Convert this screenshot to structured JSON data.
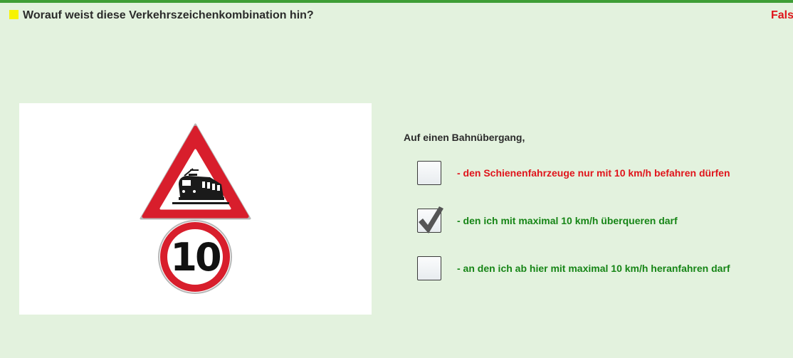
{
  "question": {
    "text": "Worauf weist diese Verkehrszeichenkombination hin?",
    "marker_color": "#f7f300"
  },
  "result": {
    "label": "Fals",
    "color": "#e0141b"
  },
  "image": {
    "sign_top": "railway-crossing-warning-triangle",
    "sign_bottom": "speed-limit-circle",
    "speed_limit_text": "10"
  },
  "answers": {
    "intro": "Auf einen Bahnübergang,",
    "options": [
      {
        "text": "- den Schienenfahrzeuge nur mit 10 km/h befahren dürfen",
        "checked": false,
        "color": "#e0141b"
      },
      {
        "text": "- den ich mit maximal 10 km/h überqueren darf",
        "checked": true,
        "color": "#168516"
      },
      {
        "text": "- an den ich ab hier mit maximal 10 km/h heranfahren darf",
        "checked": false,
        "color": "#168516"
      }
    ]
  },
  "colors": {
    "background": "#e3f2de",
    "top_bar": "#3f9e36",
    "sign_red": "#d81e2c"
  }
}
